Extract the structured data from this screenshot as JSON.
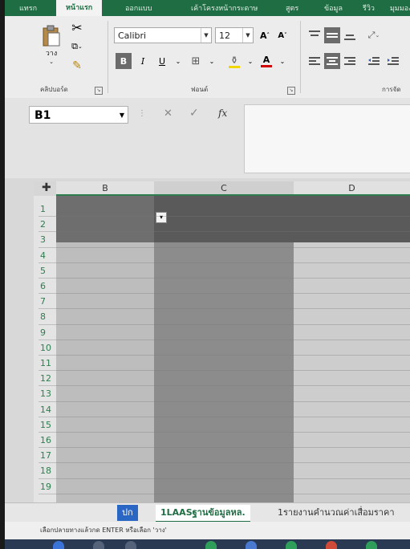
{
  "ribbon": {
    "tabs": [
      "แทรก",
      "หน้าแรก",
      "ออกแบบ",
      "เค้าโครงหน้ากระดาษ",
      "สูตร",
      "ข้อมูล",
      "รีวิว",
      "มุมมอง"
    ],
    "active_tab": "หน้าแรก",
    "clipboard": {
      "group_label": "คลิปบอร์ด",
      "paste_label": "วาง"
    },
    "font": {
      "group_label": "ฟอนต์",
      "font_name": "Calibri",
      "font_size": "12",
      "bold": "B",
      "italic": "I",
      "underline": "U",
      "grow": "A",
      "shrink": "A",
      "font_color": "A"
    },
    "alignment": {
      "group_label": "การจัด"
    }
  },
  "formula_bar": {
    "name_box": "B1",
    "cancel": "✕",
    "enter": "✓",
    "fx": "fx",
    "formula": ""
  },
  "grid": {
    "columns": [
      "B",
      "C",
      "D"
    ],
    "rows": [
      "1",
      "2",
      "3",
      "4",
      "5",
      "6",
      "7",
      "8",
      "9",
      "10",
      "11",
      "12",
      "13",
      "14",
      "15",
      "16",
      "17",
      "18",
      "19"
    ],
    "filter_arrow": "▾"
  },
  "sheet_tabs": {
    "nav_label": "ปก",
    "tabs": [
      "1LAASฐานข้อมูลหล.",
      "1รายงานคำนวณค่าเสื่อมราคา"
    ],
    "active_tab": "1LAASฐานข้อมูลหล."
  },
  "status_bar": {
    "text": "เลือกปลายทางแล้วกด ENTER หรือเลือก 'วาง'"
  },
  "colors": {
    "excel_green": "#1f6e43",
    "selection_dark": "#5a5a5a",
    "column_c": "#8c8c8c"
  }
}
